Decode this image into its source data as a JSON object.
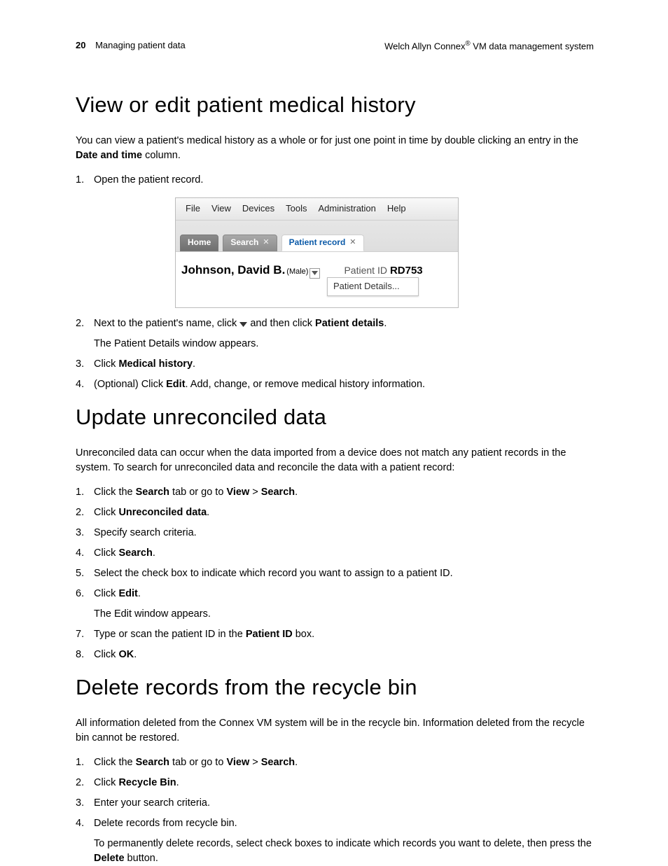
{
  "header": {
    "page_number": "20",
    "chapter": "Managing patient data",
    "product_prefix": "Welch Allyn Connex",
    "product_suffix": " VM data management system"
  },
  "s1": {
    "heading": "View or edit patient medical history",
    "intro_a": "You can view a patient's medical history as a whole or for just one point in time by double clicking an entry in the ",
    "intro_bold": "Date and time",
    "intro_b": " column.",
    "step1_num": "1.",
    "step1": "Open the patient record.",
    "step2_num": "2.",
    "step2_a": "Next to the patient's name, click ",
    "step2_b": " and then click ",
    "step2_bold": "Patient details",
    "step2_c": ".",
    "step2_sub": "The Patient Details window appears.",
    "step3_num": "3.",
    "step3_a": "Click ",
    "step3_bold": "Medical history",
    "step3_b": ".",
    "step4_num": "4.",
    "step4_a": "(Optional) Click ",
    "step4_bold": "Edit",
    "step4_b": ". Add, change, or remove medical history information."
  },
  "ui": {
    "menu": {
      "file": "File",
      "view": "View",
      "devices": "Devices",
      "tools": "Tools",
      "admin": "Administration",
      "help": "Help"
    },
    "tabs": {
      "home": "Home",
      "search": "Search",
      "patient": "Patient record",
      "close": "✕"
    },
    "patient_name": "Johnson, David B.",
    "patient_gender": "(Male)",
    "patient_id_label": "Patient ID",
    "patient_id_value": "RD753",
    "patient_details_menu": "Patient Details..."
  },
  "s2": {
    "heading": "Update unreconciled data",
    "intro": "Unreconciled data can occur when the data imported from a device does not match any patient records in the system. To search for unreconciled data and reconcile the data with a patient record:",
    "n1": "1.",
    "t1a": "Click the ",
    "t1b1": "Search",
    "t1c": " tab or go to ",
    "t1b2": "View",
    "t1d": " > ",
    "t1b3": "Search",
    "t1e": ".",
    "n2": "2.",
    "t2a": "Click ",
    "t2b": "Unreconciled data",
    "t2c": ".",
    "n3": "3.",
    "t3": "Specify search criteria.",
    "n4": "4.",
    "t4a": "Click ",
    "t4b": "Search",
    "t4c": ".",
    "n5": "5.",
    "t5": "Select the check box to indicate which record you want to assign to a patient ID.",
    "n6": "6.",
    "t6a": "Click ",
    "t6b": "Edit",
    "t6c": ".",
    "t6_sub": "The Edit window appears.",
    "n7": "7.",
    "t7a": "Type or scan the patient ID in the ",
    "t7b": "Patient ID",
    "t7c": " box.",
    "n8": "8.",
    "t8a": "Click ",
    "t8b": "OK",
    "t8c": "."
  },
  "s3": {
    "heading": "Delete records from the recycle bin",
    "intro": "All information deleted from the Connex VM system will be in the recycle bin. Information deleted from the recycle bin cannot be restored.",
    "n1": "1.",
    "t1a": "Click the ",
    "t1b1": "Search",
    "t1c": " tab or go to ",
    "t1b2": "View",
    "t1d": " > ",
    "t1b3": "Search",
    "t1e": ".",
    "n2": "2.",
    "t2a": "Click ",
    "t2b": "Recycle Bin",
    "t2c": ".",
    "n3": "3.",
    "t3": "Enter your search criteria.",
    "n4": "4.",
    "t4": "Delete records from recycle bin.",
    "t4_sub_a": "To permanently delete records, select check boxes to indicate which records you want to delete, then press the ",
    "t4_sub_b": "Delete",
    "t4_sub_c": " button."
  }
}
